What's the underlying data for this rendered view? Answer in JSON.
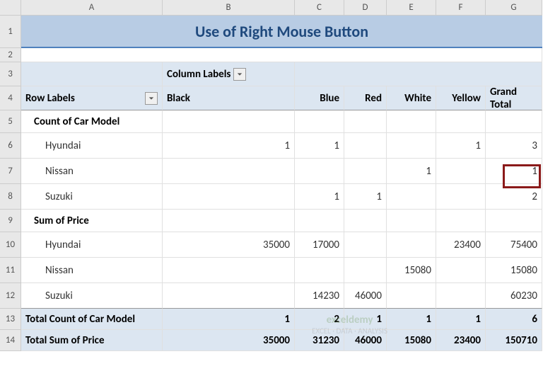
{
  "columns": [
    "A",
    "B",
    "C",
    "D",
    "E",
    "F",
    "G"
  ],
  "rows": [
    "1",
    "2",
    "3",
    "4",
    "5",
    "6",
    "7",
    "8",
    "9",
    "10",
    "11",
    "12",
    "13",
    "14"
  ],
  "title": "Use of Right Mouse Button",
  "pivot": {
    "column_labels_header": "Column Labels",
    "row_labels_header": "Row Labels",
    "colors": [
      "Black",
      "Blue",
      "Red",
      "White",
      "Yellow",
      "Grand Total"
    ],
    "sections": [
      {
        "name": "Count of Car Model",
        "rows": [
          {
            "label": "Hyundai",
            "v": [
              "1",
              "1",
              "",
              "",
              "1",
              "3"
            ]
          },
          {
            "label": "Nissan",
            "v": [
              "",
              "",
              "",
              "1",
              "",
              "1"
            ]
          },
          {
            "label": "Suzuki",
            "v": [
              "",
              "1",
              "1",
              "",
              "",
              "2"
            ]
          }
        ]
      },
      {
        "name": "Sum of Price",
        "rows": [
          {
            "label": "Hyundai",
            "v": [
              "35000",
              "17000",
              "",
              "",
              "23400",
              "75400"
            ]
          },
          {
            "label": "Nissan",
            "v": [
              "",
              "",
              "",
              "15080",
              "",
              "15080"
            ]
          },
          {
            "label": "Suzuki",
            "v": [
              "",
              "14230",
              "46000",
              "",
              "",
              "60230"
            ]
          }
        ]
      }
    ],
    "totals": [
      {
        "label": "Total Count of Car Model",
        "v": [
          "1",
          "2",
          "1",
          "1",
          "1",
          "6"
        ]
      },
      {
        "label": "Total Sum of Price",
        "v": [
          "35000",
          "31230",
          "46000",
          "15080",
          "23400",
          "150710"
        ]
      }
    ]
  },
  "watermark": {
    "brand": "exceldemy",
    "tag": "EXCEL · DATA · ANALYSIS"
  },
  "chart_data": {
    "type": "table",
    "title": "Use of Right Mouse Button",
    "columns": [
      "Black",
      "Blue",
      "Red",
      "White",
      "Yellow",
      "Grand Total"
    ],
    "groups": [
      {
        "name": "Count of Car Model",
        "rows": {
          "Hyundai": [
            1,
            1,
            null,
            null,
            1,
            3
          ],
          "Nissan": [
            null,
            null,
            null,
            1,
            null,
            1
          ],
          "Suzuki": [
            null,
            1,
            1,
            null,
            null,
            2
          ]
        }
      },
      {
        "name": "Sum of Price",
        "rows": {
          "Hyundai": [
            35000,
            17000,
            null,
            null,
            23400,
            75400
          ],
          "Nissan": [
            null,
            null,
            null,
            15080,
            null,
            15080
          ],
          "Suzuki": [
            null,
            14230,
            46000,
            null,
            null,
            60230
          ]
        }
      }
    ],
    "totals": {
      "Total Count of Car Model": [
        1,
        2,
        1,
        1,
        1,
        6
      ],
      "Total Sum of Price": [
        35000,
        31230,
        46000,
        15080,
        23400,
        150710
      ]
    }
  }
}
